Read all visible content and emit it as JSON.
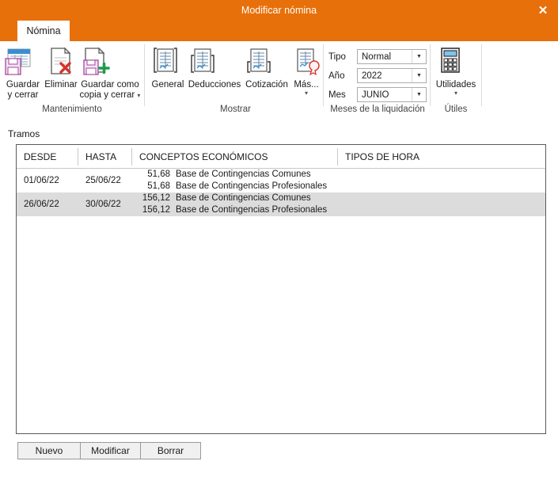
{
  "window": {
    "title": "Modificar nómina",
    "close_label": "✕",
    "accent_color": "#e8700a"
  },
  "ribbon": {
    "tab": {
      "label": "Nómina"
    },
    "groups": [
      {
        "name": "Mantenimiento",
        "label": "Mantenimiento",
        "buttons": [
          {
            "name": "guardar-y-cerrar",
            "label_line1": "Guardar",
            "label_line2": "y cerrar",
            "icon": "save-close-icon",
            "has_caret": false
          },
          {
            "name": "eliminar",
            "label_line1": "Eliminar",
            "label_line2": "",
            "icon": "delete-document-icon",
            "has_caret": false
          },
          {
            "name": "guardar-como-copia-y-cerrar",
            "label_line1": "Guardar como",
            "label_line2": "copia y cerrar",
            "icon": "save-copy-icon",
            "has_caret": true
          }
        ]
      },
      {
        "name": "Mostrar",
        "label": "Mostrar",
        "buttons": [
          {
            "name": "general",
            "label_line1": "General",
            "label_line2": "",
            "icon": "report-general-icon",
            "has_caret": false
          },
          {
            "name": "deducciones",
            "label_line1": "Deducciones",
            "label_line2": "",
            "icon": "report-deductions-icon",
            "has_caret": false
          },
          {
            "name": "cotizacion",
            "label_line1": "Cotización",
            "label_line2": "",
            "icon": "report-contribution-icon",
            "has_caret": false
          },
          {
            "name": "mas",
            "label_line1": "Más...",
            "label_line2": "",
            "icon": "report-more-icon",
            "has_caret": true
          }
        ]
      },
      {
        "name": "Meses de la liquidación",
        "label": "Meses de la liquidación",
        "fields": [
          {
            "name": "tipo",
            "label": "Tipo",
            "value": "Normal"
          },
          {
            "name": "ano",
            "label": "Año",
            "value": "2022"
          },
          {
            "name": "mes",
            "label": "Mes",
            "value": "JUNIO"
          }
        ]
      },
      {
        "name": "Útiles",
        "label": "Útiles",
        "buttons": [
          {
            "name": "utilidades",
            "label_line1": "Utilidades",
            "label_line2": "",
            "icon": "calculator-icon",
            "has_caret": true
          }
        ]
      }
    ]
  },
  "main": {
    "section_title": "Tramos",
    "grid": {
      "columns": [
        {
          "key": "desde",
          "label": "DESDE"
        },
        {
          "key": "hasta",
          "label": "HASTA"
        },
        {
          "key": "conceptos",
          "label": "CONCEPTOS ECONÓMICOS"
        },
        {
          "key": "tipos_hora",
          "label": "TIPOS DE HORA"
        }
      ],
      "rows": [
        {
          "selected": false,
          "desde": "01/06/22",
          "hasta": "25/06/22",
          "conceptos": [
            {
              "amount": "51,68",
              "text": "Base de Contingencias Comunes"
            },
            {
              "amount": "51,68",
              "text": "Base de Contingencias Profesionales"
            }
          ],
          "tipos_hora": ""
        },
        {
          "selected": true,
          "desde": "26/06/22",
          "hasta": "30/06/22",
          "conceptos": [
            {
              "amount": "156,12",
              "text": "Base de Contingencias Comunes"
            },
            {
              "amount": "156,12",
              "text": "Base de Contingencias Profesionales"
            }
          ],
          "tipos_hora": ""
        }
      ]
    },
    "buttons": [
      {
        "name": "nuevo",
        "label": "Nuevo"
      },
      {
        "name": "modificar",
        "label": "Modificar"
      },
      {
        "name": "borrar",
        "label": "Borrar"
      }
    ]
  }
}
